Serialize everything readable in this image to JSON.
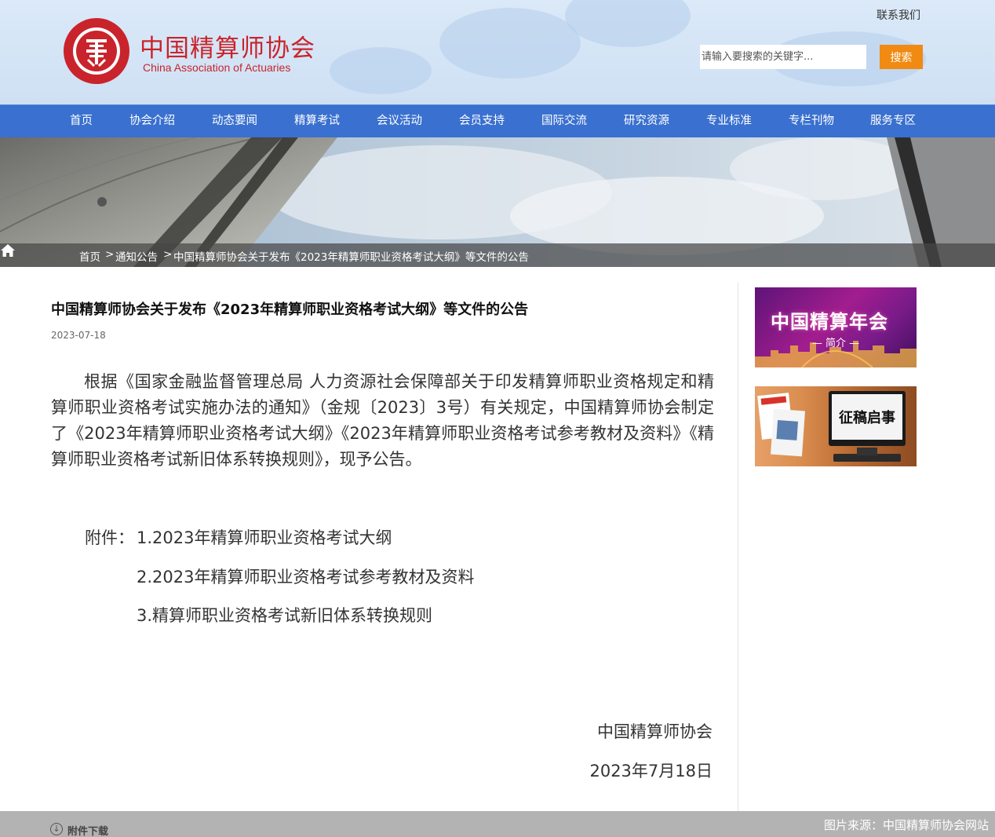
{
  "header": {
    "logo_cn": "中国精算师协会",
    "logo_en": "China Association of Actuaries",
    "logo_seal_text": "中国精算师协会 CHINA ASSOCIATION OF ACTUARIES",
    "contact_label": "联系我们",
    "search_placeholder": "请输入要搜索的关键字...",
    "search_button": "搜索"
  },
  "nav": {
    "items": [
      "首页",
      "协会介绍",
      "动态要闻",
      "精算考试",
      "会议活动",
      "会员支持",
      "国际交流",
      "研究资源",
      "专业标准",
      "专栏刊物",
      "服务专区"
    ]
  },
  "breadcrumb": {
    "home": "首页",
    "separator": ">",
    "section": "通知公告",
    "current": "中国精算师协会关于发布《2023年精算师职业资格考试大纲》等文件的公告"
  },
  "article": {
    "title": "中国精算师协会关于发布《2023年精算师职业资格考试大纲》等文件的公告",
    "date": "2023-07-18",
    "body": "根据《国家金融监督管理总局 人力资源社会保障部关于印发精算师职业资格规定和精算师职业资格考试实施办法的通知》（金规〔2023〕3号）有关规定，中国精算师协会制定了《2023年精算师职业资格考试大纲》《2023年精算师职业资格考试参考教材及资料》《精算师职业资格考试新旧体系转换规则》，现予公告。",
    "attachments_label": "附件：",
    "attachments": [
      "1.2023年精算师职业资格考试大纲",
      "2.2023年精算师职业资格考试参考教材及资料",
      "3.精算师职业资格考试新旧体系转换规则"
    ],
    "signature_org": "中国精算师协会",
    "signature_date": "2023年7月18日"
  },
  "sidebar": {
    "banner1_title": "中国精算年会",
    "banner1_sub": "简介",
    "banner2_title": "征稿启事"
  },
  "footer": {
    "download_label": "附件下载",
    "image_source": "图片来源：中国精算师协会网站"
  },
  "colors": {
    "brand_red": "#c9242b",
    "nav_blue": "#3a70cf",
    "search_orange": "#f08a12"
  }
}
